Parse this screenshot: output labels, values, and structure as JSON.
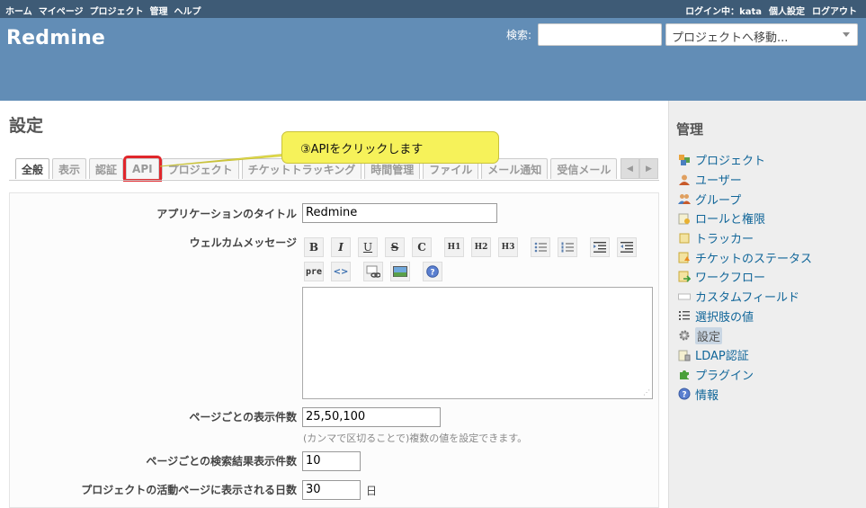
{
  "top_menu": {
    "items": [
      "ホーム",
      "マイページ",
      "プロジェクト",
      "管理",
      "ヘルプ"
    ],
    "logged_in": "ログイン中：",
    "user": "kata",
    "account": "個人設定",
    "logout": "ログアウト"
  },
  "header": {
    "app_title": "Redmine",
    "search_label": "検索:",
    "search_value": "",
    "project_jump": "プロジェクトへ移動..."
  },
  "page": {
    "title": "設定"
  },
  "tabs": [
    "全般",
    "表示",
    "認証",
    "API",
    "プロジェクト",
    "チケットトラッキング",
    "時間管理",
    "ファイル",
    "メール通知",
    "受信メール"
  ],
  "callout": "③APIをクリックします",
  "form": {
    "app_title_label": "アプリケーションのタイトル",
    "app_title_value": "Redmine",
    "welcome_label": "ウェルカムメッセージ",
    "toolbar": [
      "B",
      "I",
      "U",
      "S",
      "C",
      "H1",
      "H2",
      "H3",
      "pre",
      "<>"
    ],
    "per_page_label": "ページごとの表示件数",
    "per_page_value": "25,50,100",
    "per_page_hint": "(カンマで区切ることで)複数の値を設定できます。",
    "search_per_page_label": "ページごとの検索結果表示件数",
    "search_per_page_value": "10",
    "activity_days_label": "プロジェクトの活動ページに表示される日数",
    "activity_days_value": "30",
    "activity_days_unit": "日"
  },
  "sidebar": {
    "title": "管理",
    "items": [
      {
        "label": "プロジェクト",
        "icon": "projects-icon"
      },
      {
        "label": "ユーザー",
        "icon": "user-icon"
      },
      {
        "label": "グループ",
        "icon": "group-icon"
      },
      {
        "label": "ロールと権限",
        "icon": "roles-icon"
      },
      {
        "label": "トラッカー",
        "icon": "tracker-icon"
      },
      {
        "label": "チケットのステータス",
        "icon": "issue-status-icon"
      },
      {
        "label": "ワークフロー",
        "icon": "workflow-icon"
      },
      {
        "label": "カスタムフィールド",
        "icon": "custom-field-icon"
      },
      {
        "label": "選択肢の値",
        "icon": "list-icon"
      },
      {
        "label": "設定",
        "icon": "settings-icon"
      },
      {
        "label": "LDAP認証",
        "icon": "ldap-icon"
      },
      {
        "label": "プラグイン",
        "icon": "plugin-icon"
      },
      {
        "label": "情報",
        "icon": "help-icon"
      }
    ]
  },
  "colors": {
    "top_menu_bg": "#3e5b76",
    "header_bg": "#628db6",
    "link": "#116699",
    "callout_bg": "#f6f25a",
    "highlight_border": "#e0262b"
  }
}
